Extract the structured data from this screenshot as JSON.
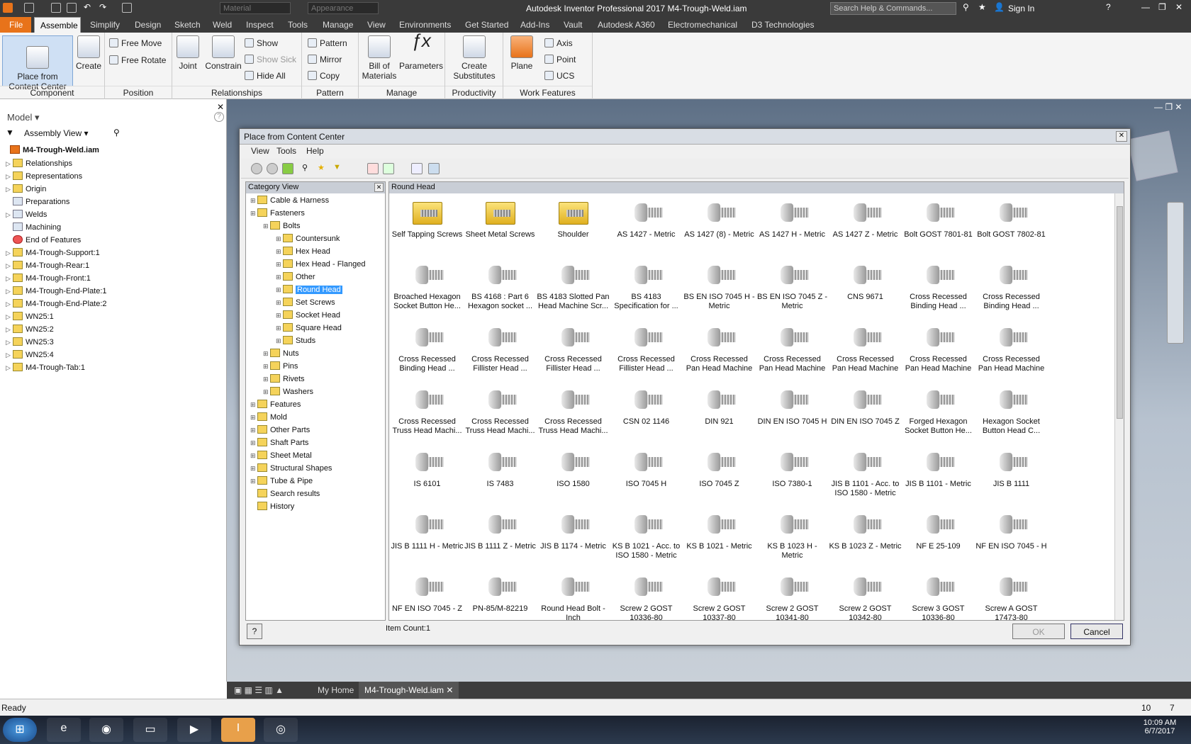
{
  "window": {
    "title": "Autodesk Inventor Professional 2017   M4-Trough-Weld.iam",
    "search_placeholder": "Search Help & Commands...",
    "sign_in": "Sign In",
    "material": "Material",
    "appearance": "Appearance"
  },
  "menus": [
    "File",
    "Assemble",
    "Simplify",
    "Design",
    "Sketch",
    "Weld",
    "Inspect",
    "Tools",
    "Manage",
    "View",
    "Environments",
    "Get Started",
    "Add-Ins",
    "Vault",
    "Autodesk A360",
    "Electromechanical",
    "D3 Technologies"
  ],
  "ribbon": {
    "component": {
      "label": "Component",
      "place": "Place from\nContent Center",
      "create": "Create"
    },
    "position": {
      "label": "Position",
      "free_move": "Free Move",
      "free_rotate": "Free Rotate"
    },
    "relationships": {
      "label": "Relationships",
      "joint": "Joint",
      "constrain": "Constrain",
      "show": "Show",
      "show_sick": "Show Sick",
      "hide_all": "Hide All"
    },
    "pattern": {
      "label": "Pattern",
      "pattern": "Pattern",
      "mirror": "Mirror",
      "copy": "Copy"
    },
    "manage": {
      "label": "Manage",
      "bom": "Bill of\nMaterials",
      "parameters": "Parameters"
    },
    "productivity": {
      "label": "Productivity",
      "create_sub": "Create\nSubstitutes"
    },
    "work": {
      "label": "Work Features",
      "plane": "Plane",
      "axis": "Axis",
      "point": "Point",
      "ucs": "UCS"
    }
  },
  "browser": {
    "header": "Model",
    "view": "Assembly View",
    "root": "M4-Trough-Weld.iam",
    "items": [
      "Relationships",
      "Representations",
      "Origin",
      "Preparations",
      "Welds",
      "Machining",
      "End of Features",
      "M4-Trough-Support:1",
      "M4-Trough-Rear:1",
      "M4-Trough-Front:1",
      "M4-Trough-End-Plate:1",
      "M4-Trough-End-Plate:2",
      "WN25:1",
      "WN25:2",
      "WN25:3",
      "WN25:4",
      "M4-Trough-Tab:1"
    ]
  },
  "dialog": {
    "title": "Place from Content Center",
    "menus": [
      "View",
      "Tools",
      "Help"
    ],
    "category_view": "Category View",
    "current": "Round Head",
    "item_count": "Item Count:1",
    "ok": "OK",
    "cancel": "Cancel",
    "tree": [
      {
        "label": "Cable & Harness",
        "level": 0
      },
      {
        "label": "Fasteners",
        "level": 0
      },
      {
        "label": "Bolts",
        "level": 1
      },
      {
        "label": "Countersunk",
        "level": 2
      },
      {
        "label": "Hex Head",
        "level": 2
      },
      {
        "label": "Hex Head - Flanged",
        "level": 2
      },
      {
        "label": "Other",
        "level": 2
      },
      {
        "label": "Round Head",
        "level": 2,
        "selected": true
      },
      {
        "label": "Set Screws",
        "level": 2
      },
      {
        "label": "Socket Head",
        "level": 2
      },
      {
        "label": "Square Head",
        "level": 2
      },
      {
        "label": "Studs",
        "level": 2
      },
      {
        "label": "Nuts",
        "level": 1
      },
      {
        "label": "Pins",
        "level": 1
      },
      {
        "label": "Rivets",
        "level": 1
      },
      {
        "label": "Washers",
        "level": 1
      },
      {
        "label": "Features",
        "level": 0
      },
      {
        "label": "Mold",
        "level": 0
      },
      {
        "label": "Other Parts",
        "level": 0
      },
      {
        "label": "Shaft Parts",
        "level": 0
      },
      {
        "label": "Sheet Metal",
        "level": 0
      },
      {
        "label": "Structural Shapes",
        "level": 0
      },
      {
        "label": "Tube & Pipe",
        "level": 0
      },
      {
        "label": "Search results",
        "level": 0
      },
      {
        "label": "History",
        "level": 0
      }
    ],
    "items": [
      "Self Tapping Screws",
      "Sheet Metal Screws",
      "Shoulder",
      "AS 1427 - Metric",
      "AS 1427 (8) - Metric",
      "AS 1427 H - Metric",
      "AS 1427 Z - Metric",
      "Bolt GOST 7801-81",
      "Bolt GOST 7802-81",
      "Broached Hexagon Socket Button He...",
      "BS 4168 : Part 6 Hexagon socket ...",
      "BS 4183 Slotted Pan Head Machine Scr...",
      "BS 4183 Specification for ...",
      "BS EN ISO 7045 H - Metric",
      "BS EN ISO 7045 Z - Metric",
      "CNS 9671",
      "Cross Recessed Binding Head ...",
      "Cross Recessed Binding Head ...",
      "Cross Recessed Binding Head ...",
      "Cross Recessed Fillister Head ...",
      "Cross Recessed Fillister Head ...",
      "Cross Recessed Fillister Head ...",
      "Cross Recessed Pan Head Machine Scr...",
      "Cross Recessed Pan Head Machine Scr...",
      "Cross Recessed Pan Head Machine Scr...",
      "Cross Recessed Pan Head Machine Scr...",
      "Cross Recessed Pan Head Machine Scr...",
      "Cross Recessed Truss Head Machi...",
      "Cross Recessed Truss Head Machi...",
      "Cross Recessed Truss Head Machi...",
      "CSN 02 1146",
      "DIN 921",
      "DIN EN ISO 7045 H",
      "DIN EN ISO 7045 Z",
      "Forged Hexagon Socket Button He...",
      "Hexagon Socket Button Head C...",
      "IS 6101",
      "IS 7483",
      "ISO 1580",
      "ISO 7045 H",
      "ISO 7045 Z",
      "ISO 7380-1",
      "JIS B 1101 - Acc. to ISO 1580 - Metric",
      "JIS B 1101 - Metric",
      "JIS B 1111",
      "JIS B 1111 H - Metric",
      "JIS B 1111 Z - Metric",
      "JIS B 1174 - Metric",
      "KS B 1021 - Acc. to ISO 1580 - Metric",
      "KS B 1021 - Metric",
      "KS B 1023 H - Metric",
      "KS B 1023 Z - Metric",
      "NF E 25-109",
      "NF EN ISO 7045 - H",
      "NF EN ISO 7045 - Z",
      "PN-85/M-82219",
      "Round Head Bolt - Inch",
      "Screw 2 GOST 10336-80",
      "Screw 2 GOST 10337-80",
      "Screw 2 GOST 10341-80",
      "Screw 2 GOST 10342-80",
      "Screw 3 GOST 10336-80",
      "Screw A GOST 17473-80"
    ]
  },
  "doctabs": {
    "home": "My Home",
    "doc": "M4-Trough-Weld.iam"
  },
  "status": {
    "text": "Ready",
    "n1": "10",
    "n2": "7"
  },
  "clock": {
    "time": "10:09 AM",
    "date": "6/7/2017"
  },
  "colors": {
    "accent": "#e8731a",
    "selection": "#3399ff",
    "dark": "#3a3a3a"
  }
}
